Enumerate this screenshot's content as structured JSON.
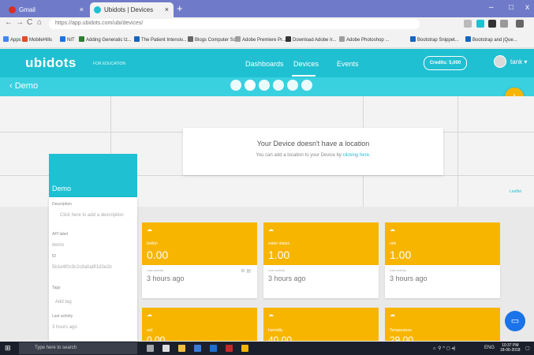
{
  "browser": {
    "tabs": [
      {
        "title": "Gmail",
        "close": "×"
      },
      {
        "title": "Ubidots | Devices",
        "close": "×"
      }
    ],
    "new_tab": "+",
    "window_controls": {
      "minimize": "–",
      "maximize": "□",
      "close": "x"
    },
    "nav": {
      "back": "←",
      "forward": "→",
      "reload": "C",
      "home": "⌂"
    },
    "address": "https://app.ubidots.com/ubi/devices/"
  },
  "bookmarks": [
    {
      "label": "Apps",
      "color": "#4285f4"
    },
    {
      "label": "MobileHills",
      "color": "#e24c2a"
    },
    {
      "label": "NIT",
      "color": "#1a73e8"
    },
    {
      "label": "Adding Generatic Iz...",
      "color": "#2e7d32"
    },
    {
      "label": "The Patient Intensiv...",
      "color": "#1565c0"
    },
    {
      "label": "Blogs Computer Sc...",
      "color": "#666666"
    },
    {
      "label": "Adobe Premiere Pr...",
      "color": "#9e9e9e"
    },
    {
      "label": "Download Adobe Ir...",
      "color": "#333333"
    },
    {
      "label": "Adobe Photoshop ...",
      "color": "#9e9e9e"
    },
    {
      "label": "Bootstrap Snippet...",
      "color": "#1565c0"
    },
    {
      "label": "Bootstrap and jQue...",
      "color": "#1565c0"
    }
  ],
  "header": {
    "logo": "ubidots",
    "logo_sub": "FOR EDUCATION",
    "nav": [
      "Dashboards",
      "Devices",
      "Events"
    ],
    "credits": "Credits: 5,000",
    "user": "tank ▾"
  },
  "subheader": {
    "title": "‹ Demo",
    "add": "+"
  },
  "map": {
    "no_location_title": "Your Device doesn't have a location",
    "no_location_text": "You can add a location to your Device by",
    "no_location_link": "clicking here.",
    "attribution": "Leaflet"
  },
  "device": {
    "name": "Demo",
    "fields": [
      {
        "label": "Description",
        "value": "Click here to add a description"
      },
      {
        "label": "API label",
        "value": "demo"
      },
      {
        "label": "ID",
        "value": "5b1e4f0c9c2c8a0a8f1d3e2b"
      },
      {
        "label": "Tags",
        "value": "Add tag"
      },
      {
        "label": "Last activity",
        "value": "3 hours ago"
      }
    ]
  },
  "widgets": [
    {
      "name": "button",
      "value": "0.00",
      "updated_label": "Last activity",
      "ago": "3 hours ago"
    },
    {
      "name": "water status",
      "value": "1.00",
      "updated_label": "Last activity",
      "ago": "3 hours ago"
    },
    {
      "name": "rain",
      "value": "1.00",
      "updated_label": "Last activity",
      "ago": "3 hours ago"
    }
  ],
  "widgets_row2": [
    {
      "name": "soil",
      "value": "0.00"
    },
    {
      "name": "humidity",
      "value": "40.00"
    },
    {
      "name": "Temperature",
      "value": "29.00"
    }
  ],
  "taskbar": {
    "search": "Type here to search",
    "time": "10:37 PM",
    "date": "18-06-2018"
  },
  "colors": {
    "brand": "#1fc0d1",
    "accent": "#f7b500",
    "tab_strip": "#6f7bc9"
  }
}
